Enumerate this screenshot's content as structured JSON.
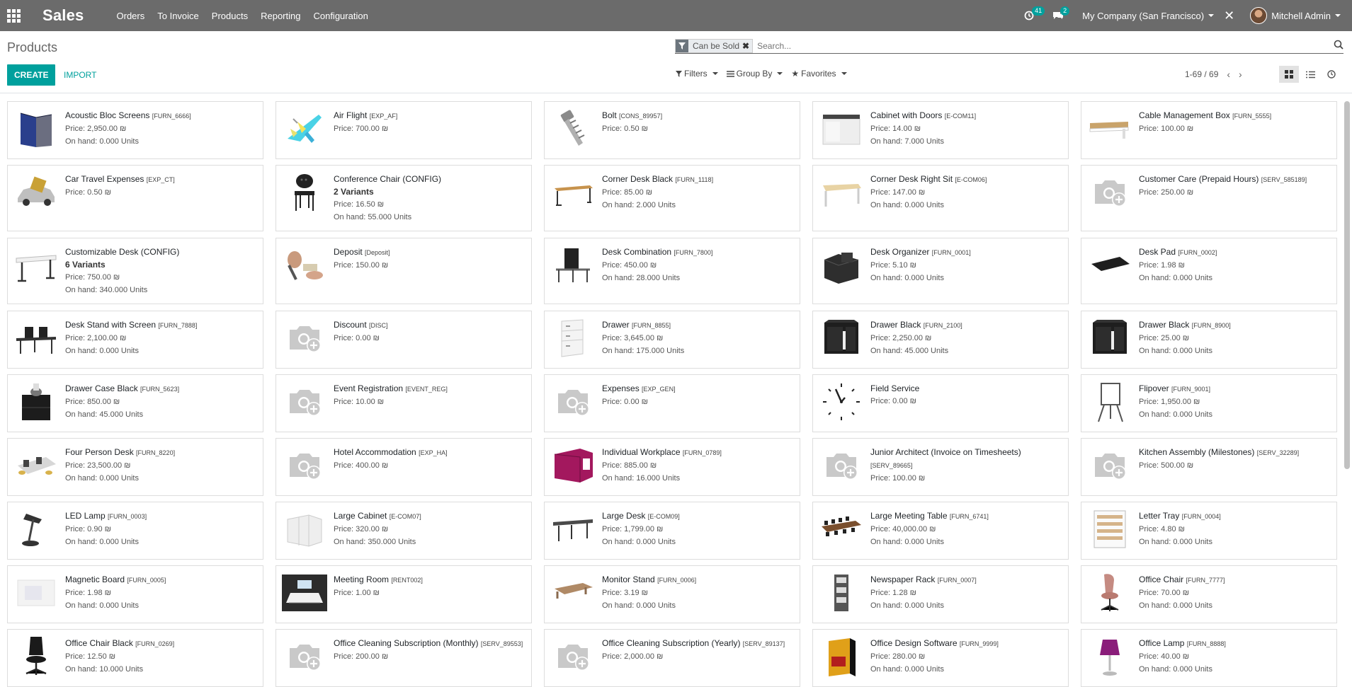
{
  "app": {
    "title": "Sales",
    "menu": [
      "Orders",
      "To Invoice",
      "Products",
      "Reporting",
      "Configuration"
    ]
  },
  "systray": {
    "activity_count": "41",
    "messages_count": "2",
    "company": "My Company (San Francisco)",
    "user": "Mitchell Admin"
  },
  "control_panel": {
    "breadcrumb": "Products",
    "facet": "Can be Sold",
    "search_placeholder": "Search...",
    "create_label": "CREATE",
    "import_label": "IMPORT",
    "filters_label": "Filters",
    "groupby_label": "Group By",
    "favorites_label": "Favorites",
    "pager": "1-69 / 69"
  },
  "colors": {
    "navbar": "#6b6b6b",
    "accent": "#00a09d"
  },
  "products": [
    {
      "name": "Acoustic Bloc Screens",
      "code": "[FURN_6666]",
      "variants": "",
      "lines": [
        "Price: 2,950.00 ₪",
        "On hand: 0.000 Units"
      ],
      "icon": "acoustic-screen"
    },
    {
      "name": "Air Flight",
      "code": "[EXP_AF]",
      "variants": "",
      "lines": [
        "Price: 700.00 ₪"
      ],
      "icon": "airplane"
    },
    {
      "name": "Bolt",
      "code": "[CONS_89957]",
      "variants": "",
      "lines": [
        "Price: 0.50 ₪"
      ],
      "icon": "bolt"
    },
    {
      "name": "Cabinet with Doors",
      "code": "[E-COM11]",
      "variants": "",
      "lines": [
        "Price: 14.00 ₪",
        "On hand: 7.000 Units"
      ],
      "icon": "cabinet"
    },
    {
      "name": "Cable Management Box",
      "code": "[FURN_5555]",
      "variants": "",
      "lines": [
        "Price: 100.00 ₪"
      ],
      "icon": "cable-box"
    },
    {
      "name": "Car Travel Expenses",
      "code": "[EXP_CT]",
      "variants": "",
      "lines": [
        "Price: 0.50 ₪"
      ],
      "icon": "car"
    },
    {
      "name": "Conference Chair (CONFIG)",
      "code": "",
      "variants": "2 Variants",
      "lines": [
        "Price: 16.50 ₪",
        "On hand: 55.000 Units"
      ],
      "icon": "chair"
    },
    {
      "name": "Corner Desk Black",
      "code": "[FURN_1118]",
      "variants": "",
      "lines": [
        "Price: 85.00 ₪",
        "On hand: 2.000 Units"
      ],
      "icon": "desk-wood"
    },
    {
      "name": "Corner Desk Right Sit",
      "code": "[E-COM06]",
      "variants": "",
      "lines": [
        "Price: 147.00 ₪",
        "On hand: 0.000 Units"
      ],
      "icon": "desk-light"
    },
    {
      "name": "Customer Care (Prepaid Hours)",
      "code": "[SERV_585189]",
      "variants": "",
      "lines": [
        "Price: 250.00 ₪"
      ],
      "icon": "placeholder"
    },
    {
      "name": "Customizable Desk (CONFIG)",
      "code": "",
      "variants": "6 Variants",
      "lines": [
        "Price: 750.00 ₪",
        "On hand: 340.000 Units"
      ],
      "icon": "desk-white"
    },
    {
      "name": "Deposit",
      "code": "[Deposit]",
      "variants": "",
      "lines": [
        "Price: 150.00 ₪"
      ],
      "icon": "deposit"
    },
    {
      "name": "Desk Combination",
      "code": "[FURN_7800]",
      "variants": "",
      "lines": [
        "Price: 450.00 ₪",
        "On hand: 28.000 Units"
      ],
      "icon": "desk-combo"
    },
    {
      "name": "Desk Organizer",
      "code": "[FURN_0001]",
      "variants": "",
      "lines": [
        "Price: 5.10 ₪",
        "On hand: 0.000 Units"
      ],
      "icon": "organizer"
    },
    {
      "name": "Desk Pad",
      "code": "[FURN_0002]",
      "variants": "",
      "lines": [
        "Price: 1.98 ₪",
        "On hand: 0.000 Units"
      ],
      "icon": "desk-pad"
    },
    {
      "name": "Desk Stand with Screen",
      "code": "[FURN_7888]",
      "variants": "",
      "lines": [
        "Price: 2,100.00 ₪",
        "On hand: 0.000 Units"
      ],
      "icon": "desk-screen"
    },
    {
      "name": "Discount",
      "code": "[DISC]",
      "variants": "",
      "lines": [
        "Price: 0.00 ₪"
      ],
      "icon": "placeholder"
    },
    {
      "name": "Drawer",
      "code": "[FURN_8855]",
      "variants": "",
      "lines": [
        "Price: 3,645.00 ₪",
        "On hand: 175.000 Units"
      ],
      "icon": "drawer-white"
    },
    {
      "name": "Drawer Black",
      "code": "[FURN_2100]",
      "variants": "",
      "lines": [
        "Price: 2,250.00 ₪",
        "On hand: 45.000 Units"
      ],
      "icon": "drawer-black"
    },
    {
      "name": "Drawer Black",
      "code": "[FURN_8900]",
      "variants": "",
      "lines": [
        "Price: 25.00 ₪",
        "On hand: 0.000 Units"
      ],
      "icon": "drawer-black"
    },
    {
      "name": "Drawer Case Black",
      "code": "[FURN_5623]",
      "variants": "",
      "lines": [
        "Price: 850.00 ₪",
        "On hand: 45.000 Units"
      ],
      "icon": "drawer-case"
    },
    {
      "name": "Event Registration",
      "code": "[EVENT_REG]",
      "variants": "",
      "lines": [
        "Price: 10.00 ₪"
      ],
      "icon": "placeholder"
    },
    {
      "name": "Expenses",
      "code": "[EXP_GEN]",
      "variants": "",
      "lines": [
        "Price: 0.00 ₪"
      ],
      "icon": "placeholder"
    },
    {
      "name": "Field Service",
      "code": "",
      "variants": "",
      "lines": [
        "Price: 0.00 ₪"
      ],
      "icon": "clock"
    },
    {
      "name": "Flipover",
      "code": "[FURN_9001]",
      "variants": "",
      "lines": [
        "Price: 1,950.00 ₪",
        "On hand: 0.000 Units"
      ],
      "icon": "flipover"
    },
    {
      "name": "Four Person Desk",
      "code": "[FURN_8220]",
      "variants": "",
      "lines": [
        "Price: 23,500.00 ₪",
        "On hand: 0.000 Units"
      ],
      "icon": "four-desk"
    },
    {
      "name": "Hotel Accommodation",
      "code": "[EXP_HA]",
      "variants": "",
      "lines": [
        "Price: 400.00 ₪"
      ],
      "icon": "placeholder"
    },
    {
      "name": "Individual Workplace",
      "code": "[FURN_0789]",
      "variants": "",
      "lines": [
        "Price: 885.00 ₪",
        "On hand: 16.000 Units"
      ],
      "icon": "workplace"
    },
    {
      "name": "Junior Architect (Invoice on Timesheets)",
      "code": "[SERV_89665]",
      "variants": "",
      "lines": [
        "Price: 100.00 ₪"
      ],
      "icon": "placeholder"
    },
    {
      "name": "Kitchen Assembly (Milestones)",
      "code": "[SERV_32289]",
      "variants": "",
      "lines": [
        "Price: 500.00 ₪"
      ],
      "icon": "placeholder"
    },
    {
      "name": "LED Lamp",
      "code": "[FURN_0003]",
      "variants": "",
      "lines": [
        "Price: 0.90 ₪",
        "On hand: 0.000 Units"
      ],
      "icon": "led-lamp"
    },
    {
      "name": "Large Cabinet",
      "code": "[E-COM07]",
      "variants": "",
      "lines": [
        "Price: 320.00 ₪",
        "On hand: 350.000 Units"
      ],
      "icon": "large-cabinet"
    },
    {
      "name": "Large Desk",
      "code": "[E-COM09]",
      "variants": "",
      "lines": [
        "Price: 1,799.00 ₪",
        "On hand: 0.000 Units"
      ],
      "icon": "large-desk"
    },
    {
      "name": "Large Meeting Table",
      "code": "[FURN_6741]",
      "variants": "",
      "lines": [
        "Price: 40,000.00 ₪",
        "On hand: 0.000 Units"
      ],
      "icon": "meeting-table"
    },
    {
      "name": "Letter Tray",
      "code": "[FURN_0004]",
      "variants": "",
      "lines": [
        "Price: 4.80 ₪",
        "On hand: 0.000 Units"
      ],
      "icon": "letter-tray"
    },
    {
      "name": "Magnetic Board",
      "code": "[FURN_0005]",
      "variants": "",
      "lines": [
        "Price: 1.98 ₪",
        "On hand: 0.000 Units"
      ],
      "icon": "board"
    },
    {
      "name": "Meeting Room",
      "code": "[RENT002]",
      "variants": "",
      "lines": [
        "Price: 1.00 ₪"
      ],
      "icon": "meeting-room"
    },
    {
      "name": "Monitor Stand",
      "code": "[FURN_0006]",
      "variants": "",
      "lines": [
        "Price: 3.19 ₪",
        "On hand: 0.000 Units"
      ],
      "icon": "monitor-stand"
    },
    {
      "name": "Newspaper Rack",
      "code": "[FURN_0007]",
      "variants": "",
      "lines": [
        "Price: 1.28 ₪",
        "On hand: 0.000 Units"
      ],
      "icon": "rack"
    },
    {
      "name": "Office Chair",
      "code": "[FURN_7777]",
      "variants": "",
      "lines": [
        "Price: 70.00 ₪",
        "On hand: 0.000 Units"
      ],
      "icon": "pink-chair"
    },
    {
      "name": "Office Chair Black",
      "code": "[FURN_0269]",
      "variants": "",
      "lines": [
        "Price: 12.50 ₪",
        "On hand: 10.000 Units"
      ],
      "icon": "black-chair"
    },
    {
      "name": "Office Cleaning Subscription (Monthly)",
      "code": "[SERV_89553]",
      "variants": "",
      "lines": [
        "Price: 200.00 ₪"
      ],
      "icon": "placeholder"
    },
    {
      "name": "Office Cleaning Subscription (Yearly)",
      "code": "[SERV_89137]",
      "variants": "",
      "lines": [
        "Price: 2,000.00 ₪"
      ],
      "icon": "placeholder"
    },
    {
      "name": "Office Design Software",
      "code": "[FURN_9999]",
      "variants": "",
      "lines": [
        "Price: 280.00 ₪",
        "On hand: 0.000 Units"
      ],
      "icon": "software-box"
    },
    {
      "name": "Office Lamp",
      "code": "[FURN_8888]",
      "variants": "",
      "lines": [
        "Price: 40.00 ₪",
        "On hand: 0.000 Units"
      ],
      "icon": "purple-lamp"
    }
  ]
}
